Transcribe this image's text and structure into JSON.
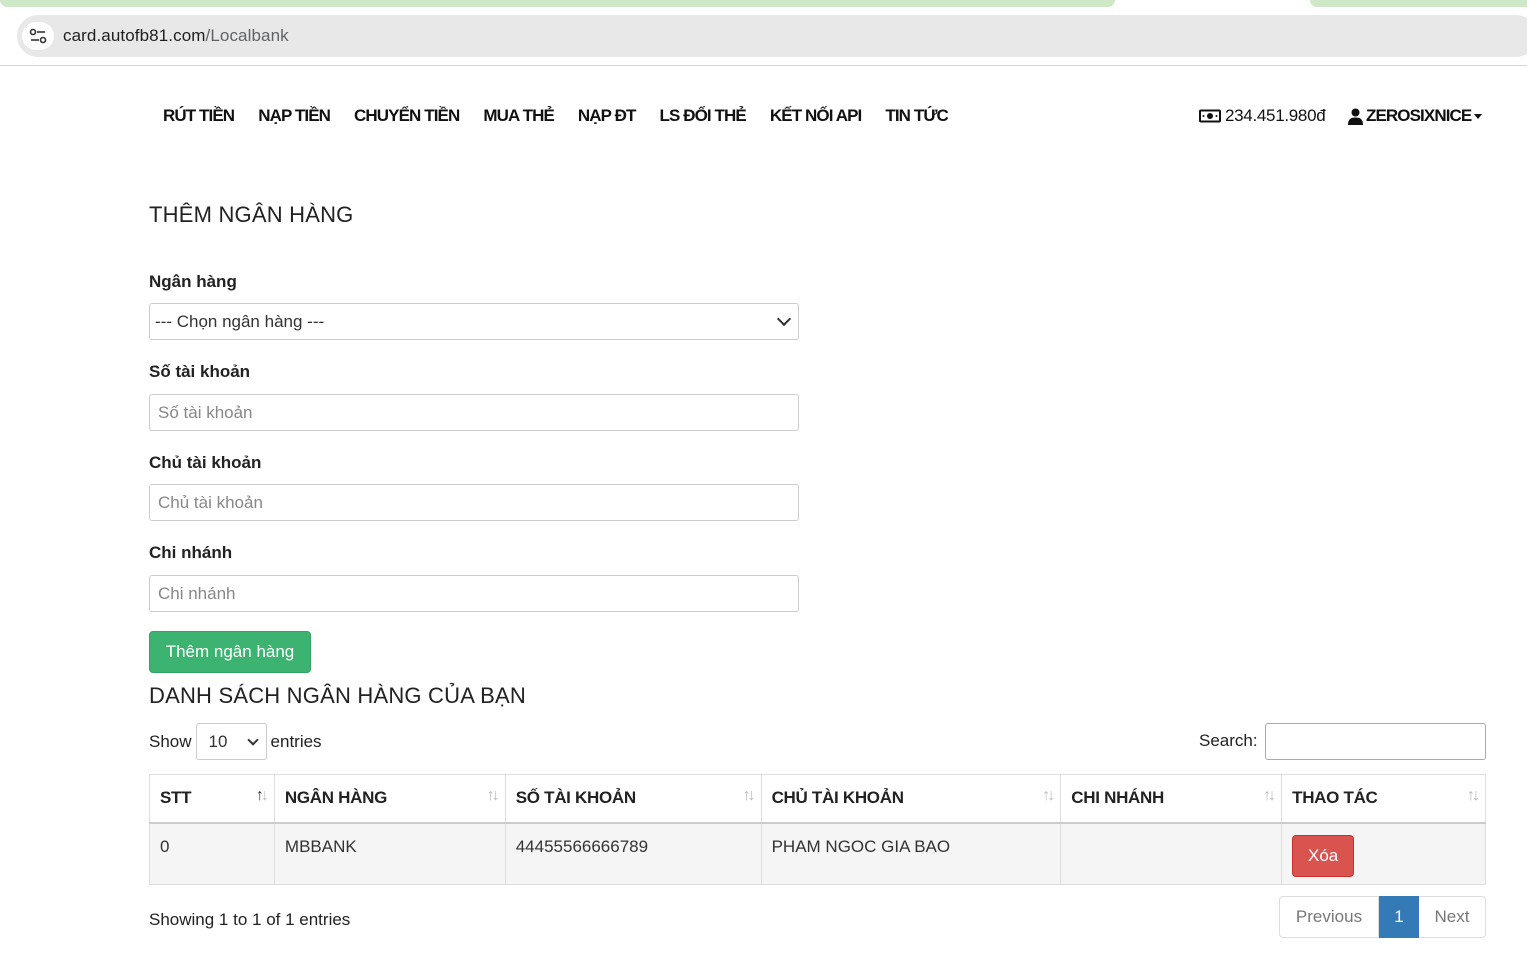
{
  "browser": {
    "url_host": "card.autofb81.com",
    "url_path": "/Localbank"
  },
  "nav": {
    "items": [
      "RÚT TIỀN",
      "NẠP TIỀN",
      "CHUYỂN TIỀN",
      "MUA THẺ",
      "NẠP ĐT",
      "LS ĐỔI THẺ",
      "KẾT NỐI API",
      "TIN TỨC"
    ],
    "balance": "234.451.980đ",
    "username": "ZEROSIXNICE"
  },
  "form": {
    "title": "THÊM NGÂN HÀNG",
    "bank_label": "Ngân hàng",
    "bank_selected": "--- Chọn ngân hàng ---",
    "account_no_label": "Số tài khoản",
    "account_no_placeholder": "Số tài khoản",
    "owner_label": "Chủ tài khoản",
    "owner_placeholder": "Chủ tài khoản",
    "branch_label": "Chi nhánh",
    "branch_placeholder": "Chi nhánh",
    "submit_label": "Thêm ngân hàng"
  },
  "list": {
    "title": "DANH SÁCH NGÂN HÀNG CỦA BẠN",
    "show_label": "Show",
    "page_length": "10",
    "entries_label": "entries",
    "search_label": "Search:",
    "columns": [
      "STT",
      "NGÂN HÀNG",
      "SỐ TÀI KHOẢN",
      "CHỦ TÀI KHOẢN",
      "CHI NHÁNH",
      "THAO TÁC"
    ],
    "rows": [
      {
        "stt": "0",
        "bank": "MBBANK",
        "account_no": "44455566666789",
        "owner": "PHAM NGOC GIA BAO",
        "branch": "",
        "action": "Xóa"
      }
    ],
    "info": "Showing 1 to 1 of 1 entries",
    "pager": {
      "previous": "Previous",
      "current": "1",
      "next": "Next"
    }
  },
  "colors": {
    "success": "#3cb371",
    "danger": "#d9534f",
    "primary": "#337ab7"
  }
}
